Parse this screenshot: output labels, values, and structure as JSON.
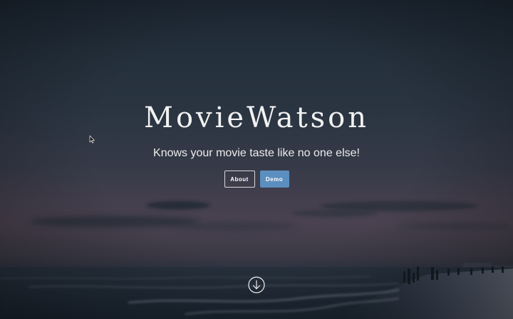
{
  "hero": {
    "title": "MovieWatson",
    "subtitle": "Knows your movie taste like no one else!"
  },
  "buttons": {
    "about_label": "About",
    "demo_label": "Demo"
  },
  "icons": {
    "scroll_down": "arrow-down-circle-icon",
    "cursor": "mouse-pointer-icon"
  },
  "colors": {
    "demo_button": "#5b8fc0",
    "about_border": "#d9d9d9"
  }
}
